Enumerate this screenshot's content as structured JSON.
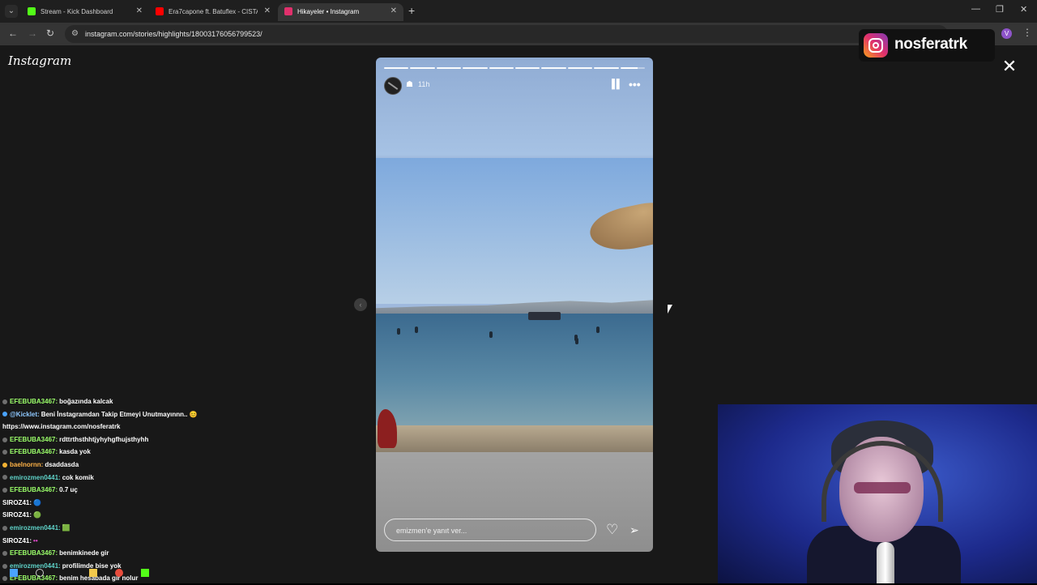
{
  "browser": {
    "tabs": [
      {
        "label": "Stream - Kick Dashboard",
        "favicon_color": "#53fc18",
        "active": false
      },
      {
        "label": "Era7capone ft. Batuflex - CISTA...",
        "favicon_color": "#ff0000",
        "active": false
      },
      {
        "label": "Hikayeler • Instagram",
        "favicon_color": "#e1306c",
        "active": true
      }
    ],
    "new_tab_label": "+",
    "url": "instagram.com/stories/highlights/18003176056799523/",
    "profile_initial": "V"
  },
  "page": {
    "logo_text": "Instagram",
    "close_label": "✕",
    "prev_label": "‹"
  },
  "overlay": {
    "username": "nosferatrk"
  },
  "story": {
    "segments": 10,
    "current_segment": 10,
    "audience_icon": "close-friends-icon",
    "time": "11h",
    "reply_placeholder": "emizmen'e yanıt ver...",
    "pause_label": "▌▌",
    "more_label": "•••",
    "like_label": "♡",
    "send_label": "➢"
  },
  "chat": [
    {
      "user": "EFEBUBA3467:",
      "user_color": "#9bff6a",
      "message": "boğazında kalcak"
    },
    {
      "user": "@Kicklet:",
      "user_color": "#8ec8ff",
      "message": "Beni İnstagramdan Takip Etmeyi Unutmayınnn.. 😊"
    },
    {
      "user": "",
      "user_color": "#ffffff",
      "message": "https://www.instagram.com/nosferatrk"
    },
    {
      "user": "EFEBUBA3467:",
      "user_color": "#9bff6a",
      "message": "rdttrthsthhtjyhyhgfhujsthyhh"
    },
    {
      "user": "EFEBUBA3467:",
      "user_color": "#9bff6a",
      "message": "kasda yok"
    },
    {
      "user": "baelnornn:",
      "user_color": "#ffb347",
      "message": "dsaddasda"
    },
    {
      "user": "emirozmen0441:",
      "user_color": "#5fd3c9",
      "message": "cok komik"
    },
    {
      "user": "EFEBUBA3467:",
      "user_color": "#9bff6a",
      "message": "0.7 uç"
    },
    {
      "user": "SIROZ41:",
      "user_color": "#ffffff",
      "message": "🔵"
    },
    {
      "user": "SIROZ41:",
      "user_color": "#ffffff",
      "message": "🟢"
    },
    {
      "user": "emirozmen0441:",
      "user_color": "#5fd3c9",
      "message": "🟩"
    },
    {
      "user": "SIROZ41:",
      "user_color": "#ffffff",
      "message": "••"
    },
    {
      "user": "EFEBUBA3467:",
      "user_color": "#9bff6a",
      "message": "benimkinede gir"
    },
    {
      "user": "emirozmen0441:",
      "user_color": "#5fd3c9",
      "message": "profilimde bise yok"
    },
    {
      "user": "EFEBUBA3467:",
      "user_color": "#9bff6a",
      "message": "benim hesabada gir nolur"
    }
  ]
}
